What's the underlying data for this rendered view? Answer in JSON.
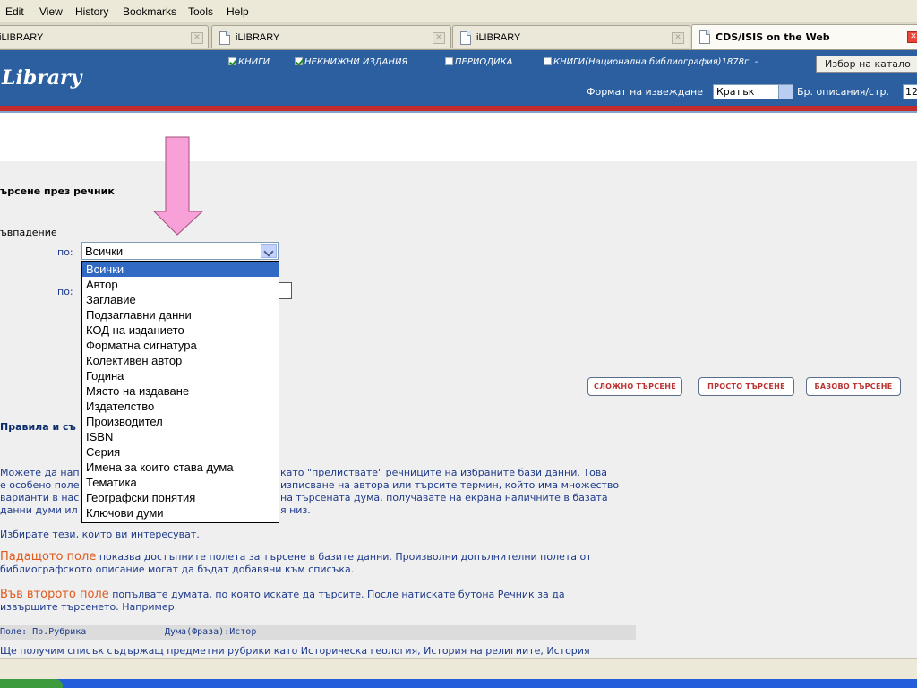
{
  "menu": [
    "Edit",
    "View",
    "History",
    "Bookmarks",
    "Tools",
    "Help"
  ],
  "tabs": [
    {
      "label": "iLIBRARY",
      "active": false
    },
    {
      "label": "iLIBRARY",
      "active": false
    },
    {
      "label": "iLIBRARY",
      "active": false
    },
    {
      "label": "CDS/ISIS on the Web",
      "active": true
    }
  ],
  "header": {
    "logo": "Library",
    "checkboxes": [
      {
        "label": "КНИГИ",
        "checked": true
      },
      {
        "label": "НЕКНИЖНИ ИЗДАНИЯ",
        "checked": true
      },
      {
        "label": "ПЕРИОДИКА",
        "checked": false
      },
      {
        "label": "КНИГИ(Национална библиография)1878г. -",
        "checked": false
      }
    ],
    "catalog_button": "Избор на катало",
    "format_label": "Формат на извеждане",
    "format_value": "Кратък",
    "perpage_label": "Бр. описания/стр.",
    "perpage_value": "12"
  },
  "search": {
    "title": "ърсене през речник",
    "match_label": "ъвпадение",
    "po1": "по:",
    "po2": "по:",
    "field_value": "Всички",
    "options": [
      "Всички",
      "Автор",
      "Заглавие",
      "Подзаглавни данни",
      "КОД на изданието",
      "Форматна сигнатура",
      "Колективен автор",
      "Година",
      "Място на издаване",
      "Издателство",
      "Производител",
      "ISBN",
      "Серия",
      "Имена за които става дума",
      "Тематика",
      "Географски понятия",
      "Ключови думи"
    ],
    "selected_index": 0
  },
  "buttons": {
    "complex": "СЛОЖНО ТЪРСЕНЕ",
    "simple": "ПРОСТО ТЪРСЕНЕ",
    "basic": "БАЗОВО ТЪРСЕНЕ"
  },
  "rules": {
    "title": "Правила и съ",
    "p1_lines": [
      "Можете да нап",
      "е особено поле",
      "варианти в нас",
      "данни думи ил"
    ],
    "p1_right": [
      "като \"прелиствате\" речниците на избраните бази данни. Това",
      "изписване на автора или търсите термин, който има множество",
      "на търсената дума, получавате на екрана наличните в базата",
      "я низ."
    ],
    "p2": "Избирате тези, които ви интересуват.",
    "p3_hl": "Падащото поле",
    "p3_a": " показва достъпните полета за търсене в базите данни. Произволни допълнителни полета от",
    "p3_b": "библиографското описание могат да бъдат добавяни към списъка.",
    "p4_hl": "Във второто поле",
    "p4_a": " попълвате думата, по която искате да търсите. После натискате бутона Речник за да",
    "p4_b": "извършите търсенето. Например:",
    "example_field": "Поле: Пр.Рубрика",
    "example_term": "Дума(Фраза):Истор",
    "p5": "Ще получим списък съдържащ предметни рубрики като Историческа геология, История на религиите, История"
  },
  "colors": {
    "header_blue": "#2b5f9f",
    "accent_red": "#c42b2b",
    "highlight_orange": "#e05a1c",
    "selection_blue": "#316ac5",
    "arrow_pink": "#f7a1d8"
  }
}
